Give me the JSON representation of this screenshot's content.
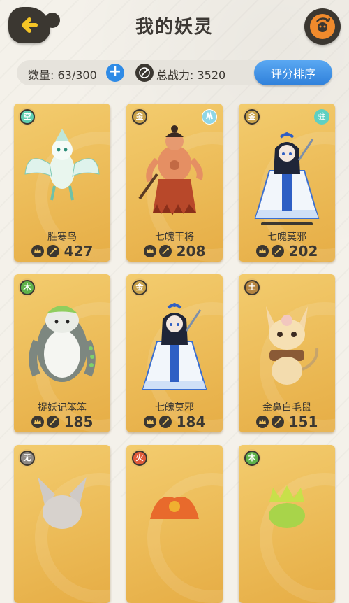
{
  "header": {
    "title": "我的妖灵",
    "back_icon": "back-arrow-icon",
    "refresh_icon": "refresh-pet-icon"
  },
  "stats": {
    "count_label": "数量: 63/300",
    "power_label": "总战力: 3520",
    "sort_button": "评分排序",
    "add_icon": "+"
  },
  "colors": {
    "card_gold": "#f0c460",
    "accent_blue": "#2f8be6",
    "dark": "#3b3731",
    "refresh_orange": "#f08a2c"
  },
  "cards": [
    {
      "element": "空",
      "name": "胜寒鸟",
      "power": "427",
      "status": "",
      "status_icon": "",
      "selected": false,
      "figure": "white-bird"
    },
    {
      "element": "金",
      "name": "七魄干将",
      "power": "208",
      "status": "",
      "status_icon": "gesture-icon",
      "selected": false,
      "figure": "warrior"
    },
    {
      "element": "金",
      "name": "七魄莫邪",
      "power": "202",
      "status": "驻",
      "status_icon": "",
      "selected": true,
      "figure": "blue-girl"
    },
    {
      "element": "木",
      "name": "捉妖记笨笨",
      "power": "185",
      "status": "",
      "status_icon": "",
      "selected": false,
      "figure": "white-yeti"
    },
    {
      "element": "金",
      "name": "七魄莫邪",
      "power": "184",
      "status": "",
      "status_icon": "",
      "selected": false,
      "figure": "blue-girl"
    },
    {
      "element": "土",
      "name": "金鼻白毛鼠",
      "power": "151",
      "status": "",
      "status_icon": "",
      "selected": false,
      "figure": "mouse"
    },
    {
      "element": "无",
      "name": "",
      "power": "",
      "status": "",
      "status_icon": "",
      "selected": false,
      "figure": "gray-wolf"
    },
    {
      "element": "火",
      "name": "",
      "power": "",
      "status": "",
      "status_icon": "",
      "selected": false,
      "figure": "fire-creature"
    },
    {
      "element": "木",
      "name": "",
      "power": "",
      "status": "",
      "status_icon": "",
      "selected": false,
      "figure": "green-creature"
    }
  ]
}
